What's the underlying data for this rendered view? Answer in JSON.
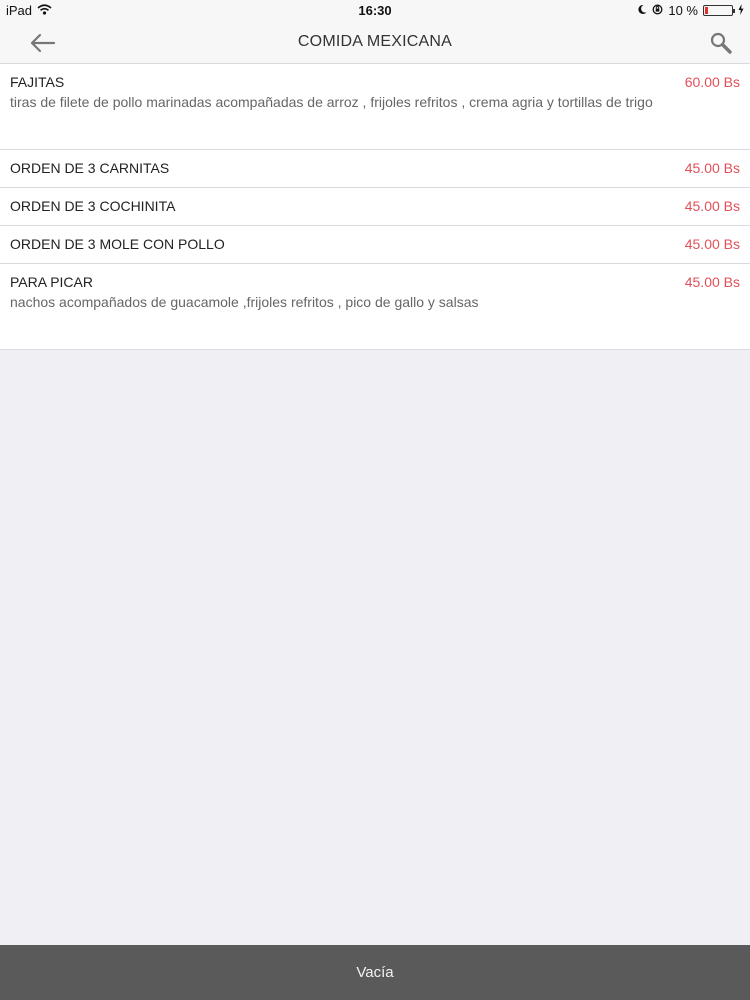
{
  "status_bar": {
    "device": "iPad",
    "time": "16:30",
    "battery_text": "10 %"
  },
  "nav": {
    "title": "COMIDA MEXICANA",
    "back_icon": "back-arrow-icon",
    "search_icon": "search-icon"
  },
  "items": [
    {
      "name": "FAJITAS",
      "description": "tiras de filete de pollo marinadas acompañadas de arroz , frijoles refritos , crema agria y tortillas de trigo",
      "price": "60.00 Bs"
    },
    {
      "name": "ORDEN DE 3 CARNITAS",
      "price": "45.00 Bs"
    },
    {
      "name": "ORDEN DE 3 COCHINITA",
      "price": "45.00 Bs"
    },
    {
      "name": "ORDEN DE 3 MOLE CON POLLO",
      "price": "45.00 Bs"
    },
    {
      "name": "PARA PICAR",
      "description": "nachos acompañados de guacamole ,frijoles refritos , pico de gallo y salsas",
      "price": "45.00 Bs"
    }
  ],
  "footer": {
    "label": "Vacía"
  },
  "colors": {
    "price": "#e0505a",
    "footer_bg": "#5a5a5a",
    "background": "#efeff4"
  }
}
